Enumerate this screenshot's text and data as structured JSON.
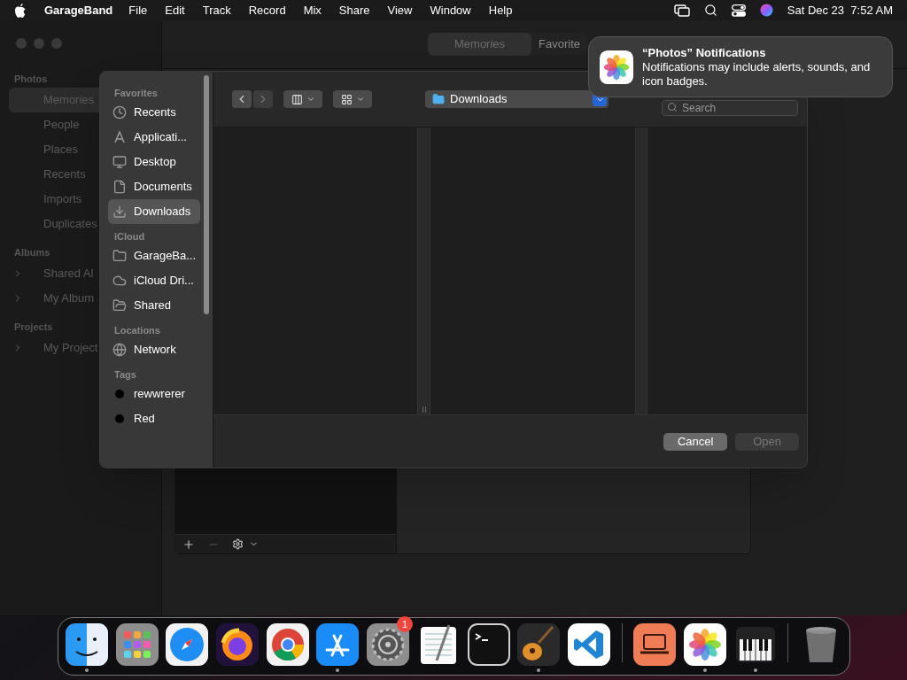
{
  "menubar": {
    "app": "GarageBand",
    "menus": [
      "File",
      "Edit",
      "Track",
      "Record",
      "Mix",
      "Share",
      "View",
      "Window",
      "Help"
    ],
    "clock": "Sat Dec 23  7:52 AM"
  },
  "photos_window": {
    "tabs": [
      {
        "label": "Memories",
        "selected": true
      },
      {
        "label": "Favorite",
        "selected": false
      }
    ],
    "sidebar": [
      {
        "title": "Photos",
        "items": [
          {
            "label": "Memories",
            "selected": true,
            "expandable": false
          },
          {
            "label": "People",
            "selected": false,
            "expandable": false
          },
          {
            "label": "Places",
            "selected": false,
            "expandable": false
          },
          {
            "label": "Recents",
            "selected": false,
            "expandable": false
          },
          {
            "label": "Imports",
            "selected": false,
            "expandable": false
          },
          {
            "label": "Duplicates",
            "selected": false,
            "expandable": false
          }
        ]
      },
      {
        "title": "Albums",
        "items": [
          {
            "label": "Shared Al",
            "selected": false,
            "expandable": true
          },
          {
            "label": "My Album",
            "selected": false,
            "expandable": true
          }
        ]
      },
      {
        "title": "Projects",
        "items": [
          {
            "label": "My Project",
            "selected": false,
            "expandable": true
          }
        ]
      }
    ]
  },
  "dialog": {
    "sidebar": [
      {
        "title": "Favorites",
        "items": [
          {
            "label": "Recents",
            "kind": "clock",
            "selected": false
          },
          {
            "label": "Applicati...",
            "kind": "apps",
            "selected": false
          },
          {
            "label": "Desktop",
            "kind": "desktop",
            "selected": false
          },
          {
            "label": "Documents",
            "kind": "document",
            "selected": false
          },
          {
            "label": "Downloads",
            "kind": "download",
            "selected": true
          }
        ]
      },
      {
        "title": "iCloud",
        "items": [
          {
            "label": "GarageBa...",
            "kind": "folder",
            "selected": false
          },
          {
            "label": "iCloud Dri...",
            "kind": "cloud",
            "selected": false
          },
          {
            "label": "Shared",
            "kind": "shared",
            "selected": false
          }
        ]
      },
      {
        "title": "Locations",
        "items": [
          {
            "label": "Network",
            "kind": "globe",
            "selected": false
          }
        ]
      },
      {
        "title": "Tags",
        "items": [
          {
            "label": "rewwrerer",
            "kind": "tag",
            "color": "#000000",
            "selected": false
          },
          {
            "label": "Red",
            "kind": "tag",
            "color": "#000000",
            "selected": false
          }
        ]
      }
    ],
    "location": "Downloads",
    "search": {
      "placeholder": "Search"
    },
    "buttons": [
      {
        "label": "Cancel",
        "disabled": false
      },
      {
        "label": "Open",
        "disabled": true
      }
    ]
  },
  "notification": {
    "title": "“Photos” Notifications",
    "body": "Notifications may include alerts, sounds, and icon badges."
  },
  "dock": [
    {
      "kind": "finder",
      "running": true
    },
    {
      "kind": "launchpad",
      "running": false
    },
    {
      "kind": "safari",
      "running": false
    },
    {
      "kind": "firefox",
      "running": false
    },
    {
      "kind": "chrome",
      "running": false
    },
    {
      "kind": "appstore",
      "running": true
    },
    {
      "kind": "settings",
      "running": false,
      "badge": "1"
    },
    {
      "kind": "textedit",
      "running": false
    },
    {
      "kind": "terminal",
      "running": false
    },
    {
      "kind": "guitar",
      "running": true
    },
    {
      "kind": "vscode",
      "running": false
    },
    {
      "kind": "sep"
    },
    {
      "kind": "laptop",
      "running": false
    },
    {
      "kind": "photos",
      "running": true
    },
    {
      "kind": "piano",
      "running": true
    },
    {
      "kind": "sep"
    },
    {
      "kind": "trash",
      "running": false
    }
  ]
}
